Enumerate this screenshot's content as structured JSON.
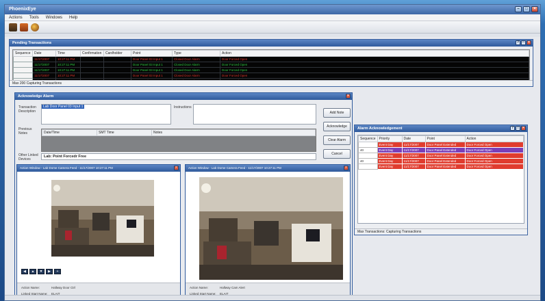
{
  "app": {
    "title": "PhoenixEye",
    "menu": [
      "Actions",
      "Tools",
      "Windows",
      "Help"
    ]
  },
  "pending": {
    "title": "Pending Transactions",
    "columns": [
      "Sequence",
      "Date",
      "Time",
      "Confirmation",
      "Cardholder",
      "Point",
      "Type",
      "Action"
    ],
    "rows": [
      {
        "seq": "",
        "date": "11/17/2007",
        "time": "10:27:11 PM",
        "point": "Door Panel 03 Input 1",
        "type": "Closed Door Alarm",
        "action": "Door Forced Open",
        "color": "red",
        "selected": true
      },
      {
        "seq": "",
        "date": "11/17/2007",
        "time": "10:27:11 PM",
        "point": "Door Panel 03 Input 1",
        "type": "Closed Door Alarm",
        "action": "Door Forced Open",
        "color": "green",
        "selected": false
      },
      {
        "seq": "",
        "date": "11/17/2007",
        "time": "10:27:11 PM",
        "point": "Door Panel 03 Input 1",
        "type": "Closed Door Alarm",
        "action": "Door Forced Open",
        "color": "green",
        "selected": false
      },
      {
        "seq": "",
        "date": "11/17/2007",
        "time": "10:27:11 PM",
        "point": "Door Panel 03 Input 1",
        "type": "Closed Door Alarm",
        "action": "Door Forced Open",
        "color": "red",
        "selected": false
      },
      {
        "seq": "",
        "date": "11/17/2007",
        "time": "10:27:11 PM",
        "point": "Door Panel 03 Input 1",
        "type": "Closed Door Alarm",
        "action": "Door Forced Open",
        "color": "red",
        "selected": false
      }
    ],
    "status": "Max 200 Capturing Transactions"
  },
  "ack": {
    "title": "Acknowledge Alarm",
    "transaction_label": "Transaction Description",
    "transaction_value": "Lab Door Panel 03 Input 1",
    "instructions_label": "Instructions",
    "previous_label": "Previous Notes",
    "prev_columns": [
      "Date/Time",
      "SMT Time",
      "Notes"
    ],
    "other_label": "Other Linked Devices",
    "other_value": "Lab: Point Forcedr Free",
    "buttons": {
      "add_note": "Add Note",
      "acknowledge": "Acknowledge",
      "clear_alarm": "Clear Alarm",
      "cancel": "Cancel"
    }
  },
  "cam1": {
    "title": "Action Window - Lab Dome Camera Feed - 11/17/2007 10:27:11 PM",
    "action_label": "Action Name:",
    "action_value": "Hallway Door Ctrl",
    "linked_label": "Linked Start Name:",
    "linked_value": "ELAIT"
  },
  "cam2": {
    "title": "Action Window - Lab Dome Camera Feed - 11/17/2007 10:27:11 PM",
    "action_label": "Action Name:",
    "action_value": "Hallway Cam Alert",
    "linked_label": "Linked Start Name:",
    "linked_value": "ELAIT"
  },
  "alarmack": {
    "title": "Alarm Acknowledgement",
    "columns": [
      "Sequence",
      "Priority",
      "Date",
      "Point",
      "Action"
    ],
    "rows": [
      {
        "seq": "",
        "priority": "Event Day",
        "date": "11/17/2007",
        "point": "Door Panel Extended",
        "action": "Door Forced Open",
        "hl": false
      },
      {
        "seq": "40",
        "priority": "Event Day",
        "date": "11/17/2007",
        "point": "Door Panel Extended",
        "action": "Door Forced Open",
        "hl": true
      },
      {
        "seq": "",
        "priority": "Event Day",
        "date": "11/17/2007",
        "point": "Door Panel Extended",
        "action": "Door Forced Open",
        "hl": false
      },
      {
        "seq": "40",
        "priority": "Event Day",
        "date": "11/17/2007",
        "point": "Door Panel Extended",
        "action": "Door Forced Open",
        "hl": false
      },
      {
        "seq": "",
        "priority": "Event Day",
        "date": "11/17/2007",
        "point": "Door Panel Extended",
        "action": "Door Forced Open",
        "hl": false
      }
    ],
    "status": "Max Transactions: Capturing Transactions"
  }
}
